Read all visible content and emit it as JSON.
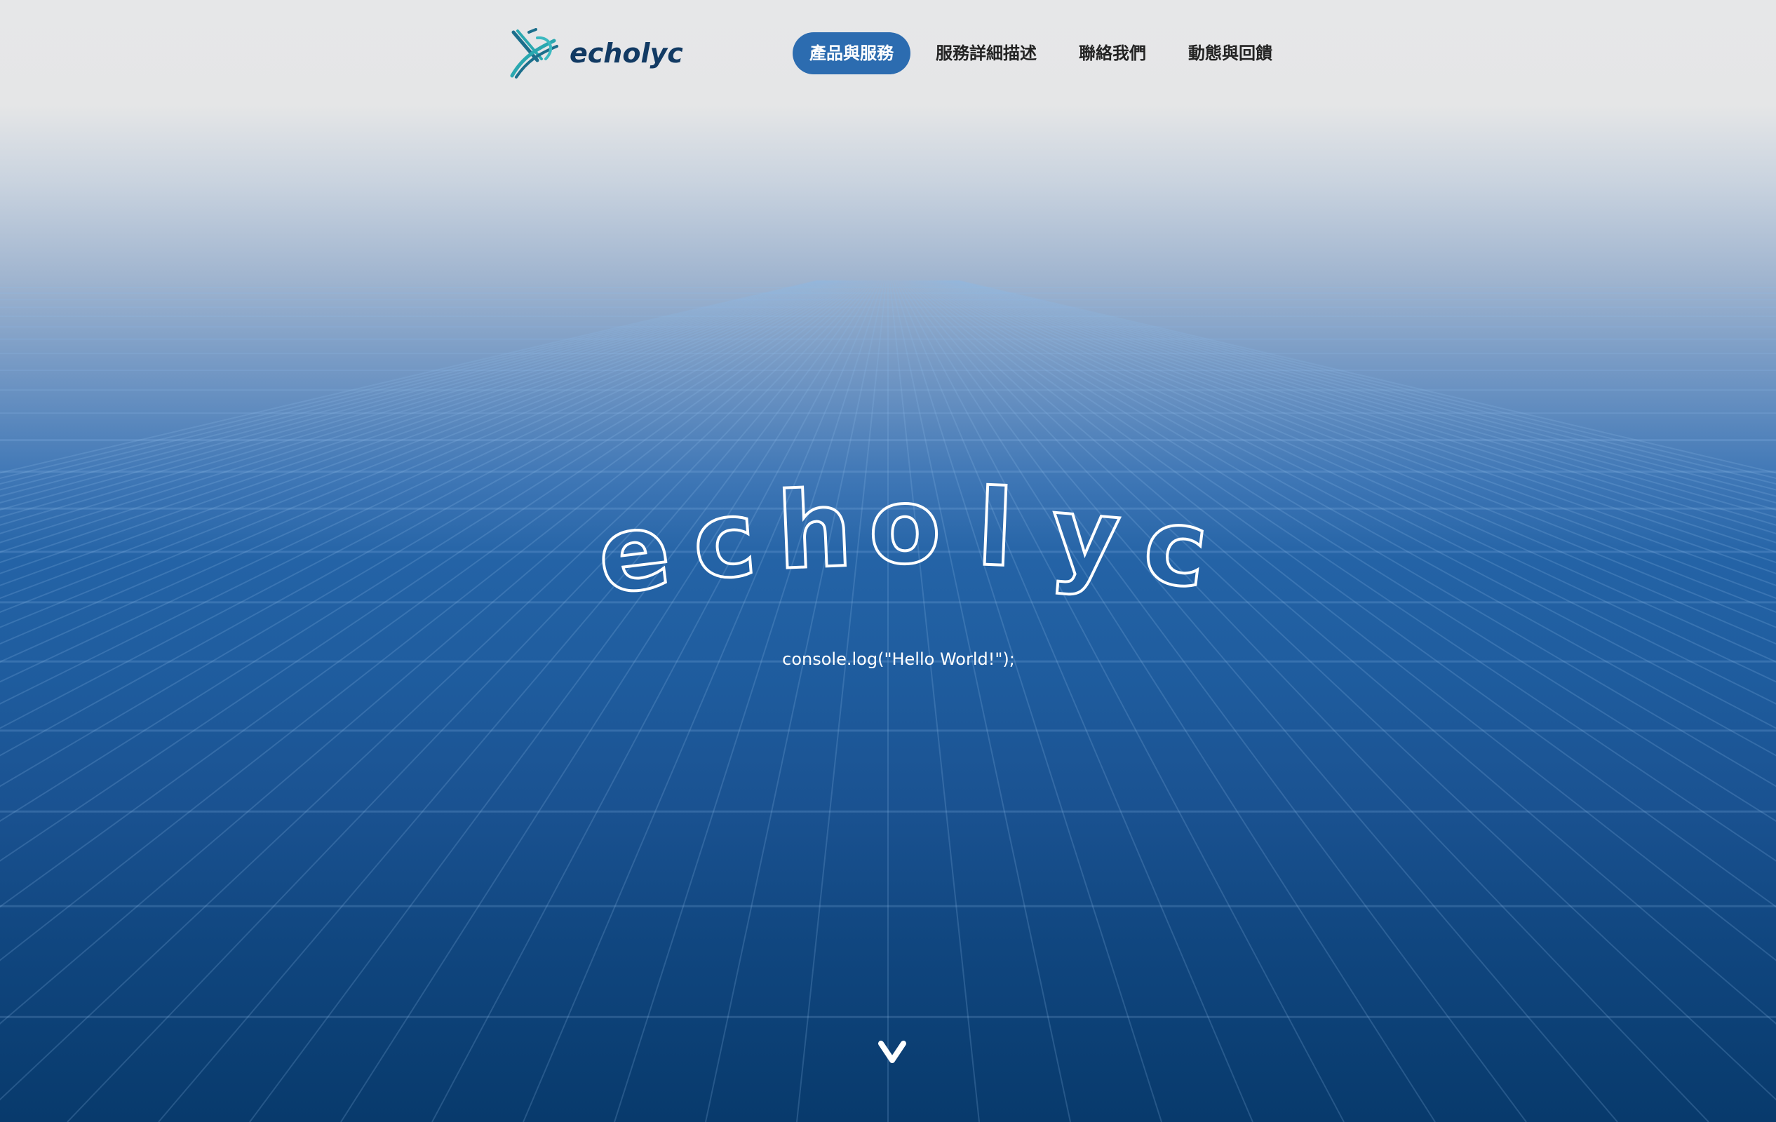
{
  "brand": {
    "name": "echolyc",
    "color": "#123a63",
    "accent": "#2aa8b0"
  },
  "nav": {
    "items": [
      {
        "label": "產品與服務",
        "active": true
      },
      {
        "label": "服務詳細描述",
        "active": false
      },
      {
        "label": "聯絡我們",
        "active": false
      },
      {
        "label": "動態與回饋",
        "active": false
      }
    ],
    "active_color": "#2c6cb0"
  },
  "hero": {
    "title": "echolyc",
    "subtitle": "console.log(\"Hello World!\");",
    "scroll_icon": "chevron-down-icon"
  },
  "colors": {
    "header_bg": "#e6e7e8",
    "hero_mid": "#2463a6",
    "hero_bottom": "#083a6c"
  }
}
